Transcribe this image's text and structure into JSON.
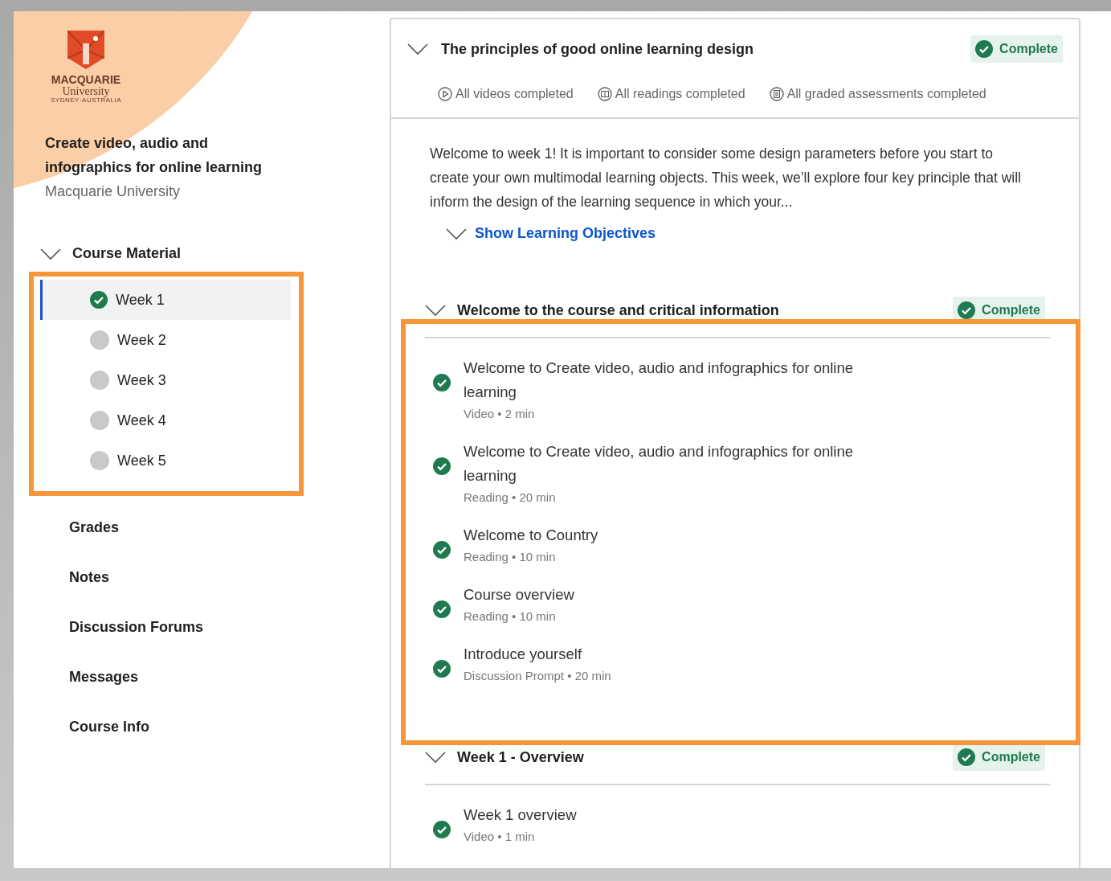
{
  "sidebar": {
    "logo": {
      "name": "MACQUARIE",
      "sub": "University",
      "tagline": "SYDNEY·AUSTRALIA"
    },
    "course_title": "Create video, audio and infographics for online learning",
    "provider": "Macquarie University",
    "course_material": {
      "label": "Course Material",
      "expanded": true,
      "weeks": [
        {
          "label": "Week 1",
          "completed": true,
          "selected": true
        },
        {
          "label": "Week 2",
          "completed": false,
          "selected": false
        },
        {
          "label": "Week 3",
          "completed": false,
          "selected": false
        },
        {
          "label": "Week 4",
          "completed": false,
          "selected": false
        },
        {
          "label": "Week 5",
          "completed": false,
          "selected": false
        }
      ]
    },
    "nav": [
      "Grades",
      "Notes",
      "Discussion Forums",
      "Messages",
      "Course Info"
    ]
  },
  "module": {
    "title": "The principles of good online learning design",
    "status": "Complete",
    "expanded": true,
    "stats": [
      {
        "kind": "video",
        "label": "All videos completed"
      },
      {
        "kind": "reading",
        "label": "All readings completed"
      },
      {
        "kind": "assessment",
        "label": "All graded assessments completed"
      }
    ],
    "description": "Welcome to week 1! It is important to consider some design parameters before you start to create your own multimodal learning objects. This week, we’ll explore four key principle that will inform the design of the learning sequence in which your...",
    "objectives_link": "Show Learning Objectives"
  },
  "sections": [
    {
      "title": "Welcome to the course and critical information",
      "status": "Complete",
      "expanded": true,
      "highlighted": true,
      "items": [
        {
          "title": "Welcome to Create video, audio and infographics for online learning",
          "meta": "Video • 2 min",
          "completed": true
        },
        {
          "title": "Welcome to Create video, audio and infographics for online learning",
          "meta": "Reading • 20 min",
          "completed": true
        },
        {
          "title": "Welcome to Country",
          "meta": "Reading • 10 min",
          "completed": true
        },
        {
          "title": "Course overview",
          "meta": "Reading • 10 min",
          "completed": true
        },
        {
          "title": "Introduce yourself",
          "meta": "Discussion Prompt • 20 min",
          "completed": true
        }
      ]
    },
    {
      "title": "Week 1 - Overview",
      "status": "Complete",
      "expanded": true,
      "highlighted": false,
      "items": [
        {
          "title": "Week 1 overview",
          "meta": "Video • 1 min",
          "completed": true
        }
      ]
    }
  ]
}
